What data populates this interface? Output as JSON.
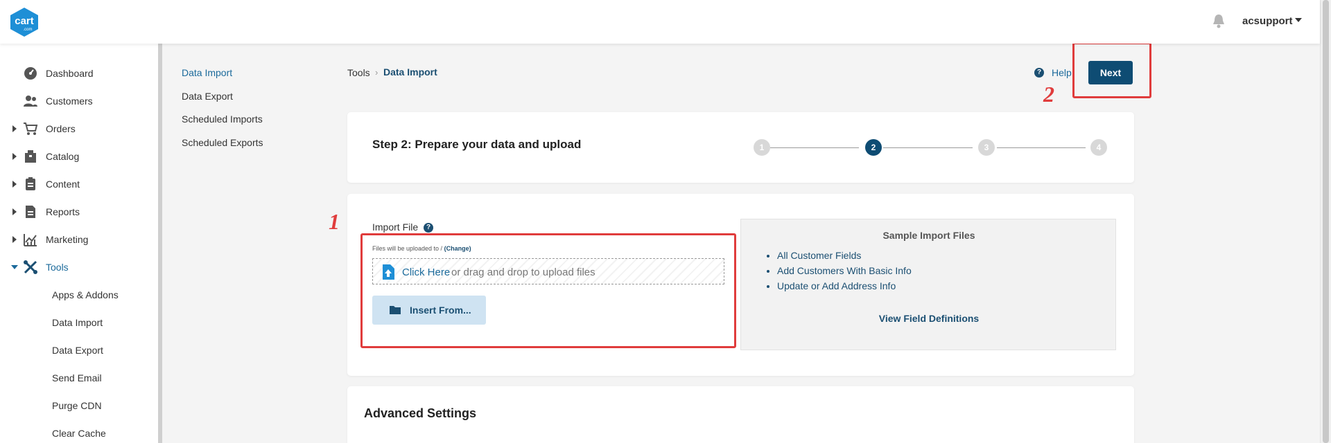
{
  "header": {
    "logo_text": "cart.com",
    "username": "acsupport"
  },
  "sidebar": {
    "items": [
      {
        "label": "Dashboard",
        "icon": "dashboard-icon"
      },
      {
        "label": "Customers",
        "icon": "customers-icon"
      },
      {
        "label": "Orders",
        "icon": "cart-icon"
      },
      {
        "label": "Catalog",
        "icon": "catalog-icon"
      },
      {
        "label": "Content",
        "icon": "content-icon"
      },
      {
        "label": "Reports",
        "icon": "reports-icon"
      },
      {
        "label": "Marketing",
        "icon": "marketing-icon"
      },
      {
        "label": "Tools",
        "icon": "tools-icon"
      }
    ],
    "tools_children": [
      "Apps & Addons",
      "Data Import",
      "Data Export",
      "Send Email",
      "Purge CDN",
      "Clear Cache"
    ]
  },
  "submenu": [
    "Data Import",
    "Data Export",
    "Scheduled Imports",
    "Scheduled Exports"
  ],
  "breadcrumb": {
    "root": "Tools",
    "separator": "›",
    "current": "Data Import"
  },
  "actions": {
    "help_label": "Help",
    "next_label": "Next"
  },
  "stepper": {
    "title": "Step 2: Prepare your data and upload",
    "steps": [
      "1",
      "2",
      "3",
      "4"
    ],
    "active_step": 2
  },
  "import": {
    "label": "Import File",
    "upload_note": "Files will be uploaded to /",
    "change_label": "(Change)",
    "click_here": "Click Here",
    "drop_text": "or drag and drop to upload files",
    "insert_label": "Insert From..."
  },
  "samples": {
    "title": "Sample Import Files",
    "links": [
      "All Customer Fields",
      "Add Customers With Basic Info",
      "Update or Add Address Info"
    ],
    "view_defs": "View Field Definitions"
  },
  "advanced": {
    "title": "Advanced Settings"
  },
  "annotations": {
    "one": "1",
    "two": "2"
  },
  "colors": {
    "accent": "#0e4c73",
    "link": "#1b6a9b",
    "annotation": "#e03c3c"
  }
}
